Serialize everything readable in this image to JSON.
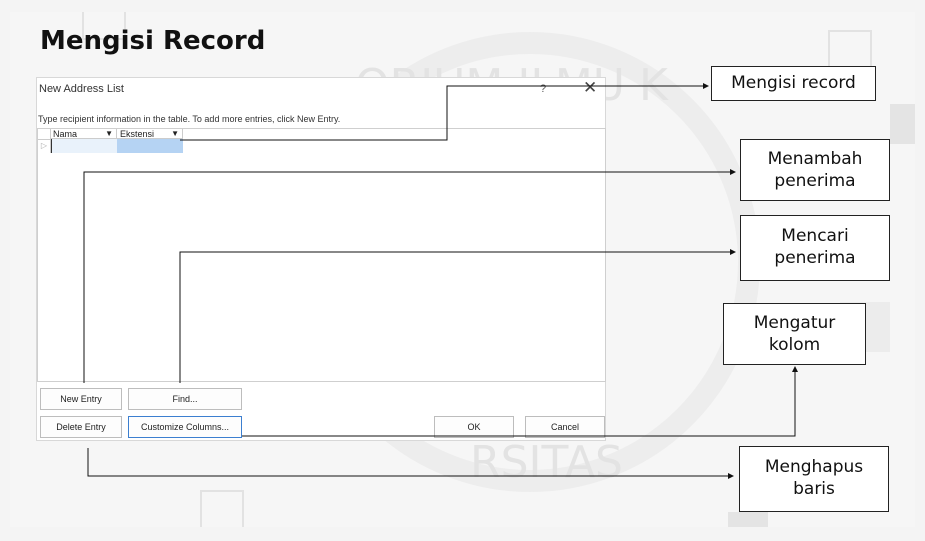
{
  "slide": {
    "title": "Mengisi Record"
  },
  "dialog": {
    "title": "New Address List",
    "help": "?",
    "close": "✕",
    "instruction": "Type recipient information in the table.  To add more entries, click New Entry.",
    "columns": [
      {
        "label": "Nama"
      },
      {
        "label": "Ekstensi"
      }
    ],
    "buttons": {
      "new_entry": "New Entry",
      "find": "Find...",
      "delete_entry": "Delete Entry",
      "customize_columns": "Customize Columns...",
      "ok": "OK",
      "cancel": "Cancel"
    }
  },
  "callouts": {
    "mengisi_record": "Mengisi record",
    "menambah_penerima_1": "Menambah",
    "menambah_penerima_2": "penerima",
    "mencari_penerima_1": "Mencari",
    "mencari_penerima_2": "penerima",
    "mengatur_kolom_1": "Mengatur",
    "mengatur_kolom_2": "kolom",
    "menghapus_baris_1": "Menghapus",
    "menghapus_baris_2": "baris"
  },
  "watermark": {
    "text_top": "ORIUM ILMU K",
    "text_bottom": "RSITAS"
  },
  "colors": {
    "selected_cell": "#b5d3f3",
    "row_highlight": "#e9f2fb",
    "focus_border": "#3c7fd0"
  }
}
